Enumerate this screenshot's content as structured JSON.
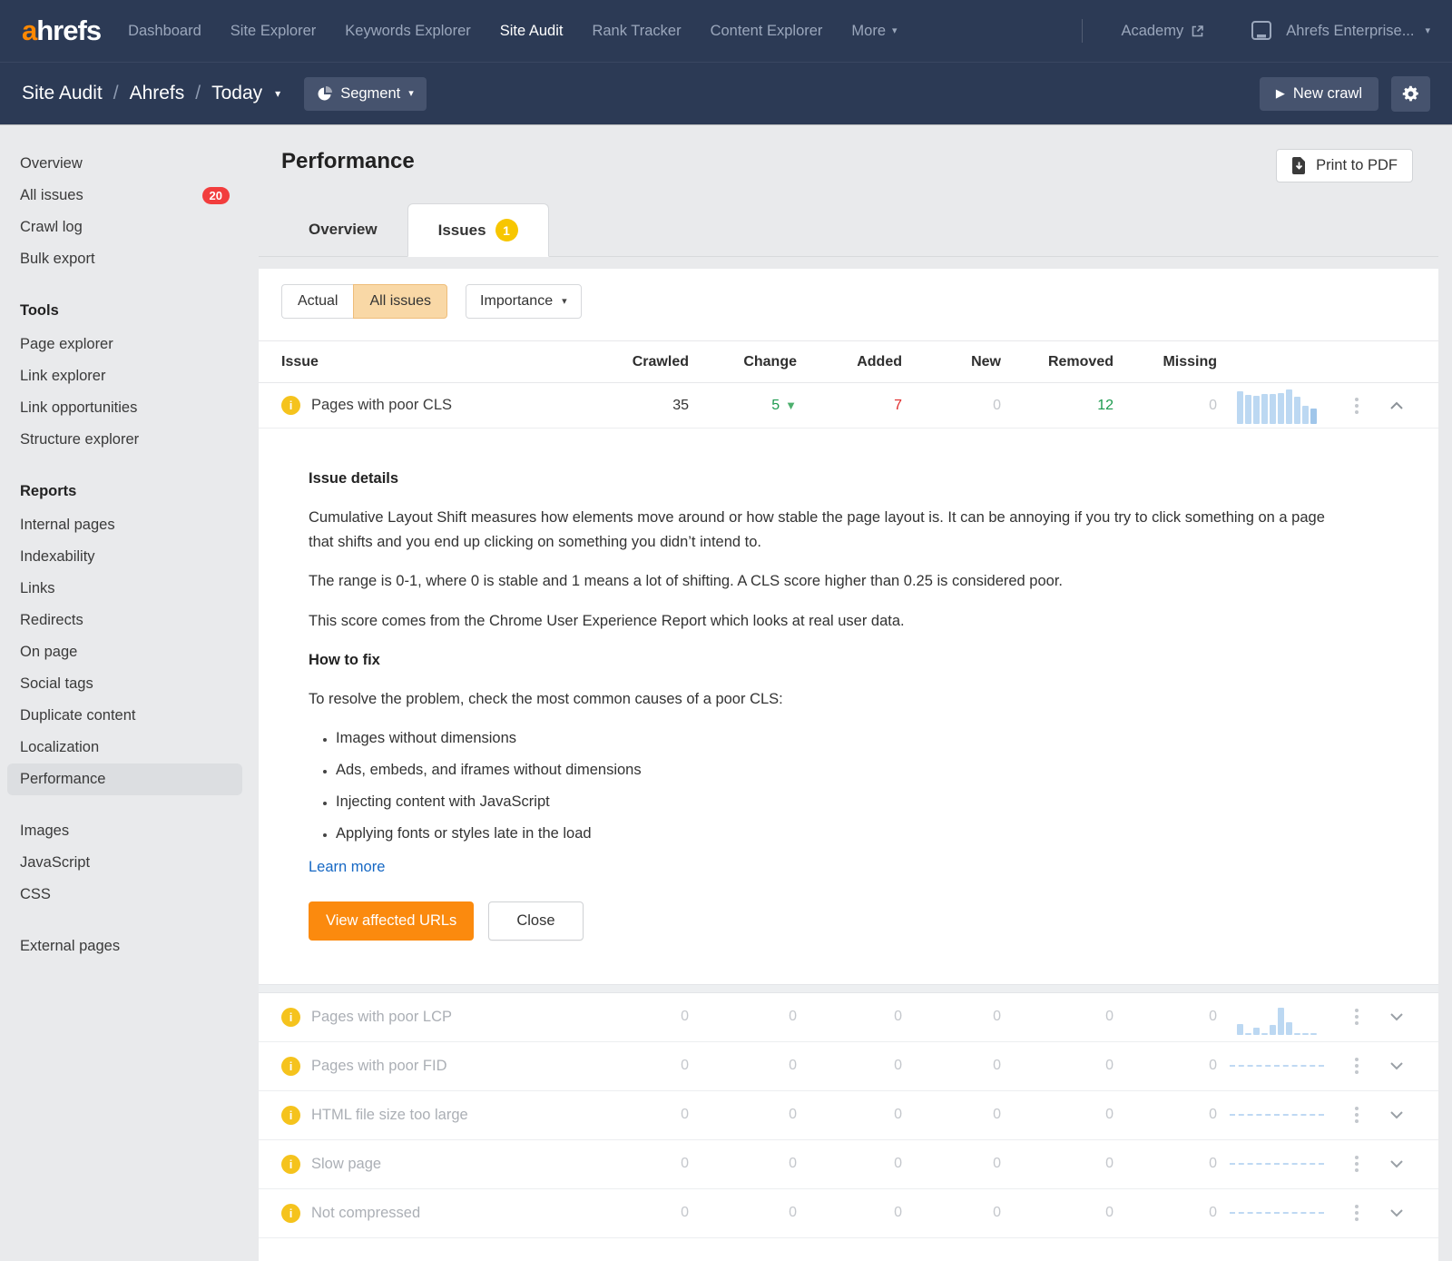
{
  "topnav": {
    "logo_a": "a",
    "logo_rest": "hrefs",
    "items": [
      {
        "label": "Dashboard"
      },
      {
        "label": "Site Explorer"
      },
      {
        "label": "Keywords Explorer"
      },
      {
        "label": "Site Audit"
      },
      {
        "label": "Rank Tracker"
      },
      {
        "label": "Content Explorer"
      },
      {
        "label": "More"
      }
    ],
    "academy": "Academy",
    "account": "Ahrefs Enterprise..."
  },
  "subnav": {
    "crumbs": [
      "Site Audit",
      "Ahrefs",
      "Today"
    ],
    "segment": "Segment",
    "new_crawl": "New crawl"
  },
  "sidebar": {
    "main_items": [
      {
        "label": "Overview"
      },
      {
        "label": "All issues",
        "badge": "20"
      },
      {
        "label": "Crawl log"
      },
      {
        "label": "Bulk export"
      }
    ],
    "tools_title": "Tools",
    "tools": [
      {
        "label": "Page explorer"
      },
      {
        "label": "Link explorer"
      },
      {
        "label": "Link opportunities"
      },
      {
        "label": "Structure explorer"
      }
    ],
    "reports_title": "Reports",
    "reports": [
      {
        "label": "Internal pages"
      },
      {
        "label": "Indexability"
      },
      {
        "label": "Links"
      },
      {
        "label": "Redirects"
      },
      {
        "label": "On page"
      },
      {
        "label": "Social tags"
      },
      {
        "label": "Duplicate content"
      },
      {
        "label": "Localization"
      },
      {
        "label": "Performance"
      }
    ],
    "assets": [
      {
        "label": "Images"
      },
      {
        "label": "JavaScript"
      },
      {
        "label": "CSS"
      }
    ],
    "external": [
      {
        "label": "External pages"
      }
    ]
  },
  "main": {
    "title": "Performance",
    "print_label": "Print to PDF",
    "tabs": [
      {
        "label": "Overview"
      },
      {
        "label": "Issues",
        "badge": "1"
      }
    ],
    "filters": {
      "actual": "Actual",
      "all_issues": "All issues",
      "importance": "Importance"
    },
    "table": {
      "columns": [
        "Issue",
        "Crawled",
        "Change",
        "Added",
        "New",
        "Removed",
        "Missing"
      ],
      "expanded": {
        "issue": "Pages with poor CLS",
        "crawled": "35",
        "change": "5",
        "added": "7",
        "new": "0",
        "removed": "12",
        "missing": "0",
        "spark": [
          0.95,
          0.85,
          0.82,
          0.88,
          0.88,
          0.9,
          1.0,
          0.78,
          0.52,
          0.46
        ]
      },
      "rows": [
        {
          "issue": "Pages with poor LCP",
          "crawled": "0",
          "change": "0",
          "added": "0",
          "new": "0",
          "removed": "0",
          "missing": "0",
          "spark": [
            0.4,
            0.07,
            0.25,
            0.07,
            0.35,
            1.0,
            0.45,
            0.07,
            0.07,
            0.07
          ]
        },
        {
          "issue": "Pages with poor FID",
          "crawled": "0",
          "change": "0",
          "added": "0",
          "new": "0",
          "removed": "0",
          "missing": "0"
        },
        {
          "issue": "HTML file size too large",
          "crawled": "0",
          "change": "0",
          "added": "0",
          "new": "0",
          "removed": "0",
          "missing": "0"
        },
        {
          "issue": "Slow page",
          "crawled": "0",
          "change": "0",
          "added": "0",
          "new": "0",
          "removed": "0",
          "missing": "0"
        },
        {
          "issue": "Not compressed",
          "crawled": "0",
          "change": "0",
          "added": "0",
          "new": "0",
          "removed": "0",
          "missing": "0"
        }
      ]
    },
    "details": {
      "title": "Issue details",
      "p1": "Cumulative Layout Shift measures how elements move around or how stable the page layout is. It can be annoying if you try to click something on a page that shifts and you end up clicking on something you didn’t intend to.",
      "p2": "The range is 0-1, where 0 is stable and 1 means a lot of shifting. A CLS score higher than 0.25 is considered poor.",
      "p3": "This score comes from the Chrome User Experience Report which looks at real user data.",
      "fix_title": "How to fix",
      "fix_intro": "To resolve the problem, check the most common causes of a poor CLS:",
      "bullets": [
        "Images without dimensions",
        "Ads, embeds, and iframes without dimensions",
        "Injecting content with JavaScript",
        "Applying fonts or styles late in the load"
      ],
      "learn_more": "Learn more",
      "view_button": "View affected URLs",
      "close_button": "Close"
    }
  },
  "colors": {
    "accent_orange": "#fb8a0e",
    "nav_navy": "#2c3a55",
    "badge_red": "#f23d3d",
    "badge_yellow": "#f7c600",
    "info_yellow": "#f5c31d",
    "positive_green": "#1c9a4e",
    "negative_red": "#e02b2b",
    "link_blue": "#1668c4",
    "spark_blue": "#bcd8f2"
  }
}
